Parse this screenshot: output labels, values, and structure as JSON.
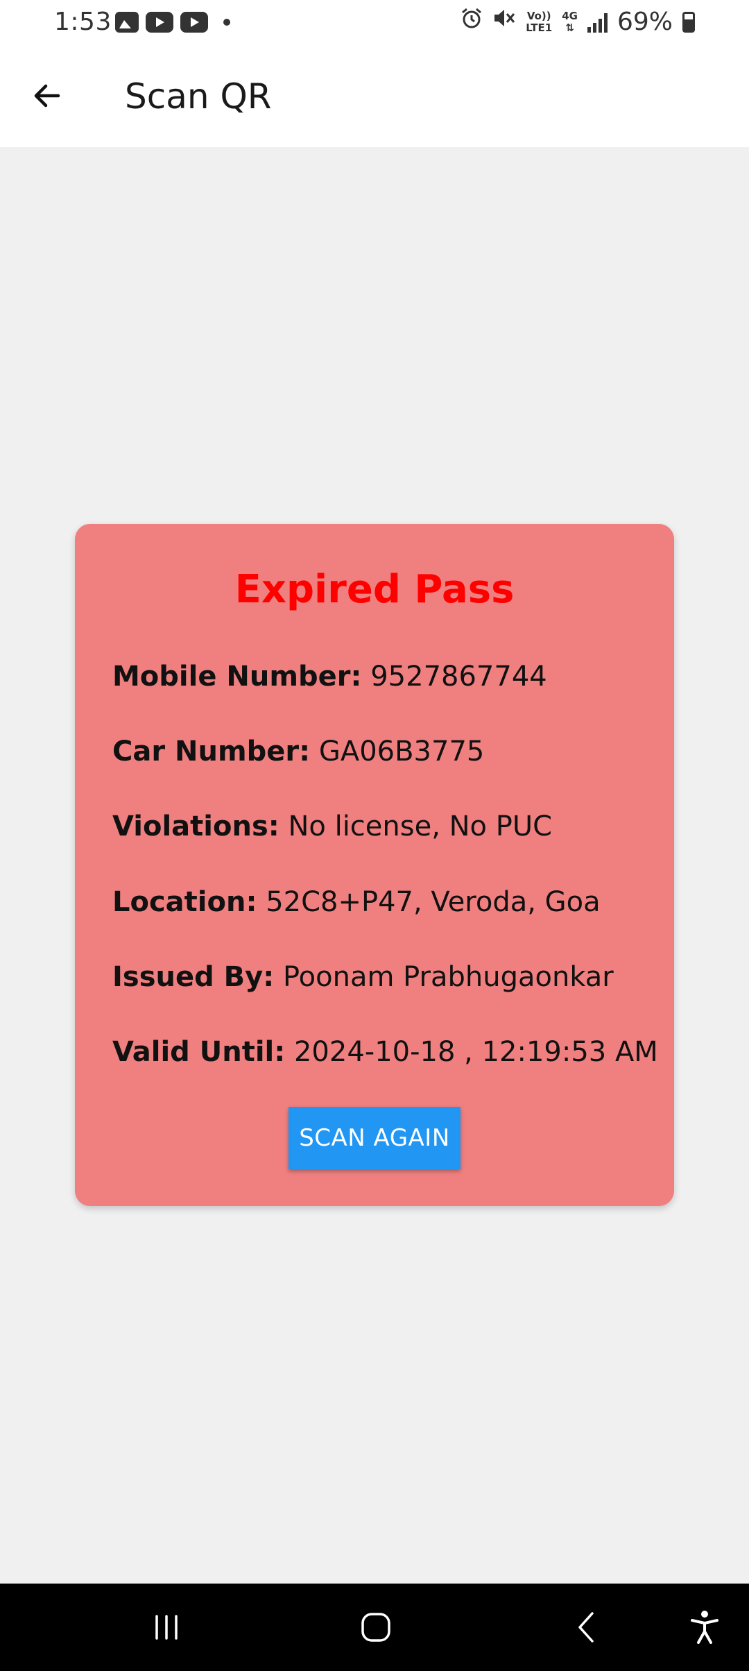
{
  "status_bar": {
    "time": "1:53",
    "notifications": [
      "gallery-icon",
      "youtube-icon",
      "youtube-icon"
    ],
    "network_top": "Vo))",
    "network_bottom": "LTE1",
    "network_type": "4G",
    "battery_percent": "69%"
  },
  "app_bar": {
    "title": "Scan QR",
    "back_icon": "arrow-back-icon"
  },
  "card": {
    "title": "Expired Pass",
    "fields": [
      {
        "label": "Mobile Number:",
        "value": "9527867744"
      },
      {
        "label": "Car Number:",
        "value": "GA06B3775"
      },
      {
        "label": "Violations:",
        "value": "No license, No PUC"
      },
      {
        "label": "Location:",
        "value": "52C8+P47, Veroda, Goa"
      },
      {
        "label": "Issued By:",
        "value": "Poonam Prabhugaonkar"
      },
      {
        "label": "Valid Until:",
        "value": "2024-10-18 , 12:19:53 AM"
      }
    ],
    "button_label": "SCAN AGAIN"
  },
  "colors": {
    "card_background": "#f08080",
    "title_color": "#ff0000",
    "button_color": "#2196f3",
    "page_background": "#f0f0f0"
  },
  "nav_bar": {
    "items": [
      "recent-apps-icon",
      "home-icon",
      "back-icon",
      "accessibility-icon"
    ]
  }
}
